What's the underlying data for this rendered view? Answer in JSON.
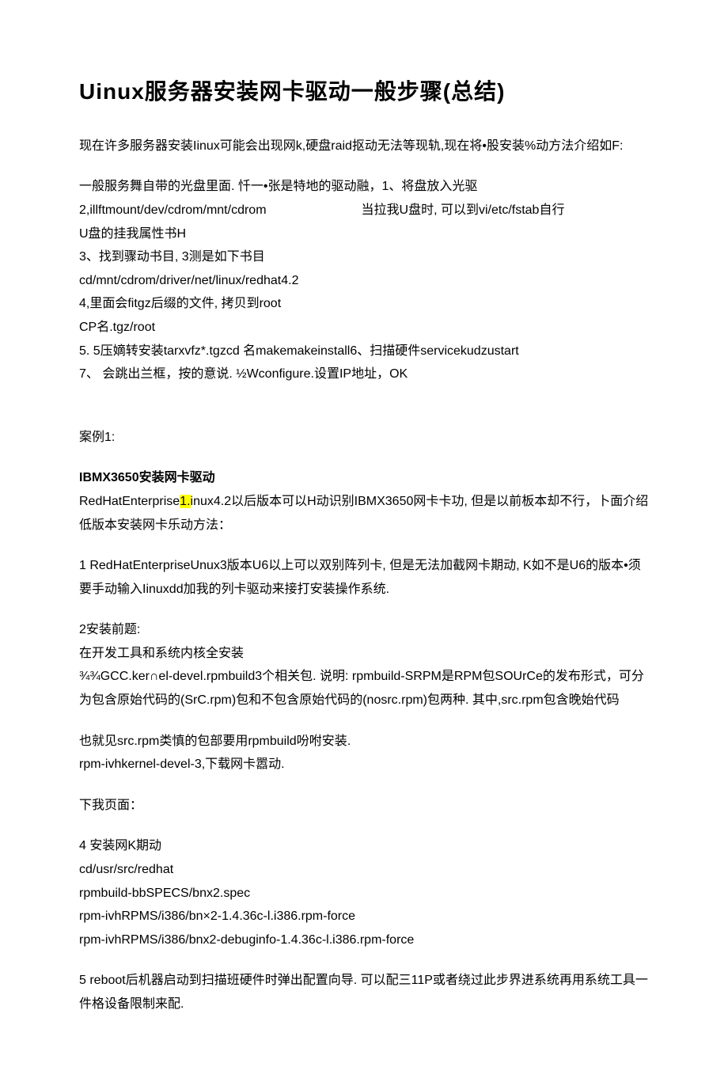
{
  "title": "Uinux服务器安装网卡驱动一般步骤(总结)",
  "intro": "现在许多服务器安装Iinux可能会出现网k,硬盘raid抠动无法等现轨,现在将•股安装%动方法介绍如F:",
  "steps": {
    "s1": "一般服务舞自带的光盘里面. 忏一•张是特地的驱动融，1、将盘放入光驱",
    "s2a": "2,illftmount/dev/cdrom/mnt/cdrom",
    "s2b": "当拉我U盘时, 可以到vi/etc/fstab自行",
    "s2c": "U盘的挂我属性书H",
    "s3": "3、找到骤动书目, 3测是如下书目",
    "s3b": "cd/mnt/cdrom/driver/net/linux/redhat4.2",
    "s4": "4,里面会fitgz后缀的文件, 拷贝到root",
    "s4b": "CP名.tgz/root",
    "s5": "5.   5压嫡转安装tarxvfz*.tgzcd 名makemakeinstall6、扫描硬件servicekudzustart",
    "s7": "7、 会跳出兰框，按的意说. ½Wconfigure.设置IP地址，OK"
  },
  "case1": {
    "heading": "案例1:",
    "h2": "IBMX3650安装网卡驱动",
    "p1a": "RedHatEnterprise",
    "p1hl": "1.",
    "p1b": "inux4.2以后版本可以H动识别IBMX3650网卡卡功, 但是以前板本却不行，卜面介绍低版本安装网卡乐动方法：",
    "p2": "1   RedHatEnterpriseUnux3版本U6以上可以双别阵列卡, 但是无法加截网卡期动, K如不是U6的版本•须要手动输入Iinuxdd加我的列卡驱动来接打安装操作系统.",
    "p3a": "2安装前题:",
    "p3b": "在开发工具和系统内核全安装",
    "p3c": "¾¾GCC.ker∩el-devel.rpmbuild3个相关包. 说明: rpmbuild-SRPM是RPM包SOUrCe的发布形式，可分为包含原始代码的(SrC.rpm)包和不包含原始代码的(nosrc.rpm)包两种. 其中,src.rpm包含晚始代码",
    "p4": "也就见src.rpm类慎的包部要用rpmbuild吩咐安装.",
    "p5": "rpm-ivhkernel-devel-3,下载网卡嚣动.",
    "p6": "下我页面：",
    "p7": "4   安装网K期动",
    "p7b": "cd/usr/src/redhat",
    "p7c": "rpmbuild-bbSPECS/bnx2.spec",
    "p7d": "rpm-ivhRPMS/i386/bn×2-1.4.36c-l.i386.rpm-force",
    "p7e": "rpm-ivhRPMS/i386/bnx2-debuginfo-1.4.36c-l.i386.rpm-force",
    "p8": "5   reboot后机器启动到扫描班硬件时弹出配置向导. 可以配三11P或者绕过此步界进系统再用系统工具一件格设备限制来配."
  }
}
